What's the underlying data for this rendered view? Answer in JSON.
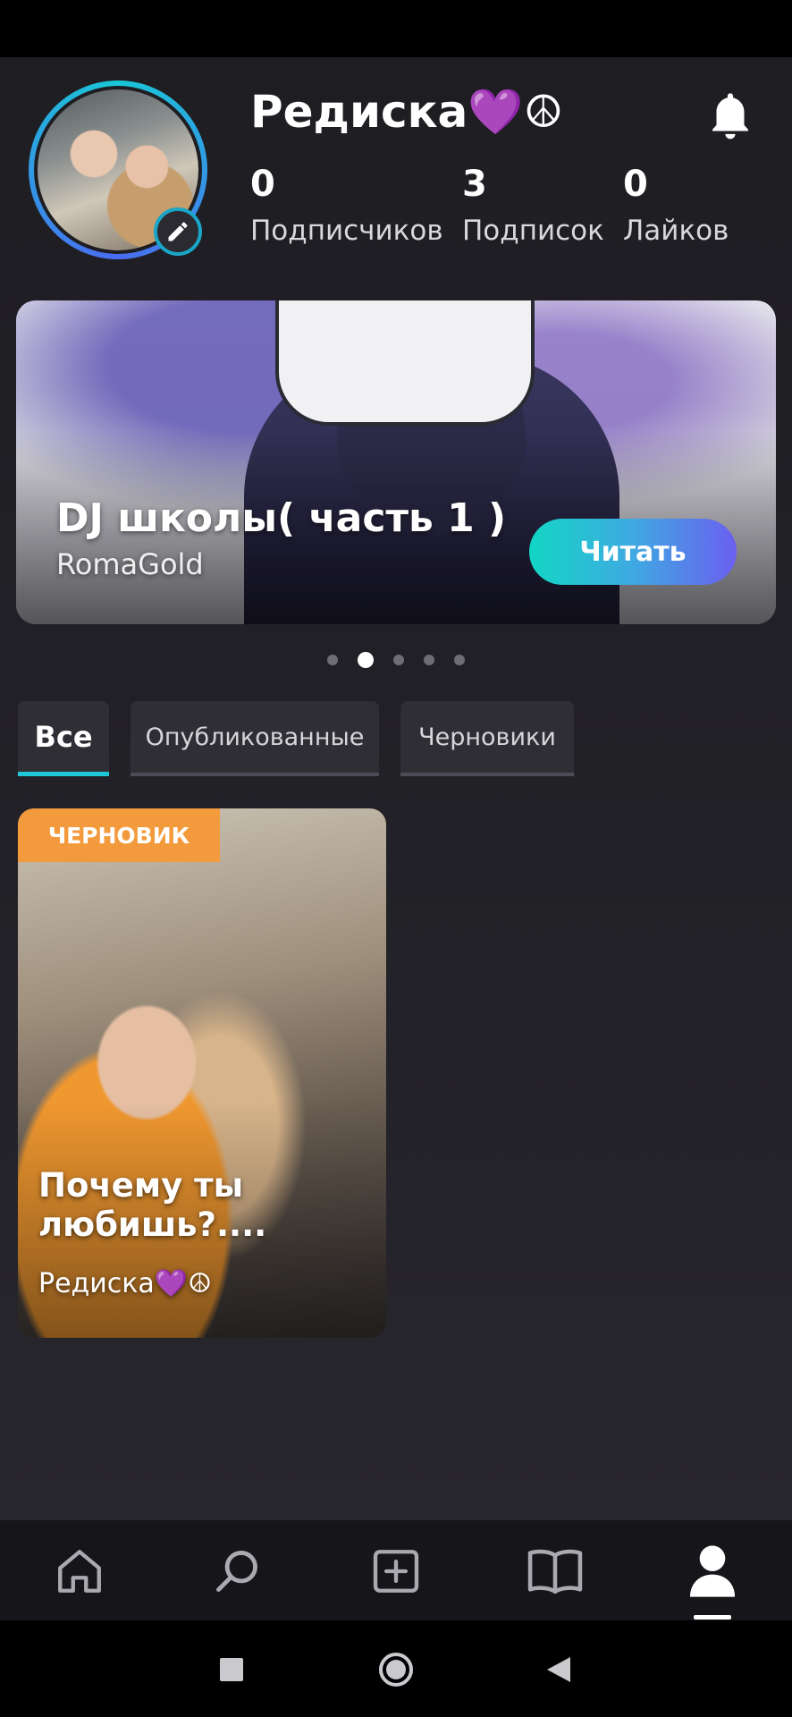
{
  "profile": {
    "name": "Редиска💜☮",
    "stats": [
      {
        "value": "0",
        "label": "Подписчиков"
      },
      {
        "value": "3",
        "label": "Подписок"
      },
      {
        "value": "0",
        "label": "Лайков"
      }
    ]
  },
  "banner": {
    "title": "DJ школы( часть 1 )",
    "author": "RomaGold",
    "read_label": "Читать",
    "pager": {
      "count": 5,
      "active": 1
    }
  },
  "tabs": [
    {
      "label": "Все",
      "active": true
    },
    {
      "label": "Опубликованные",
      "active": false
    },
    {
      "label": "Черновики",
      "active": false
    }
  ],
  "story_card": {
    "badge": "ЧЕРНОВИК",
    "title": "Почему ты любишь?....",
    "author": "Редиска💜☮"
  },
  "bottom_nav": {
    "items": [
      "home-icon",
      "search-icon",
      "add-story-icon",
      "library-book-icon",
      "profile-icon"
    ],
    "active": "profile-icon"
  },
  "system_nav": [
    "recents-square-icon",
    "home-circle-icon",
    "back-triangle-icon"
  ],
  "colors": {
    "accent_teal": "#12d6c4",
    "accent_violet": "#6b5ff0",
    "draft_orange": "#f39a3c",
    "background": "#1e1d22"
  }
}
